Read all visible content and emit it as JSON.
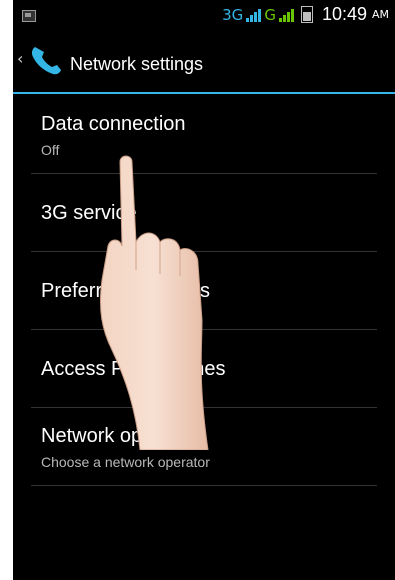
{
  "status_bar": {
    "network_3g": "3G",
    "network_g": "G",
    "time": "10:49",
    "ampm": "AM"
  },
  "action_bar": {
    "title": "Network settings"
  },
  "settings": {
    "items": [
      {
        "title": "Data connection",
        "summary": "Off"
      },
      {
        "title": "3G service"
      },
      {
        "title": "Preferred networks"
      },
      {
        "title": "Access Point Names"
      },
      {
        "title": "Network operators",
        "summary": "Choose a network operator"
      }
    ]
  },
  "colors": {
    "accent": "#33b5e5",
    "signal_green": "#6ac600",
    "background": "#000000"
  }
}
